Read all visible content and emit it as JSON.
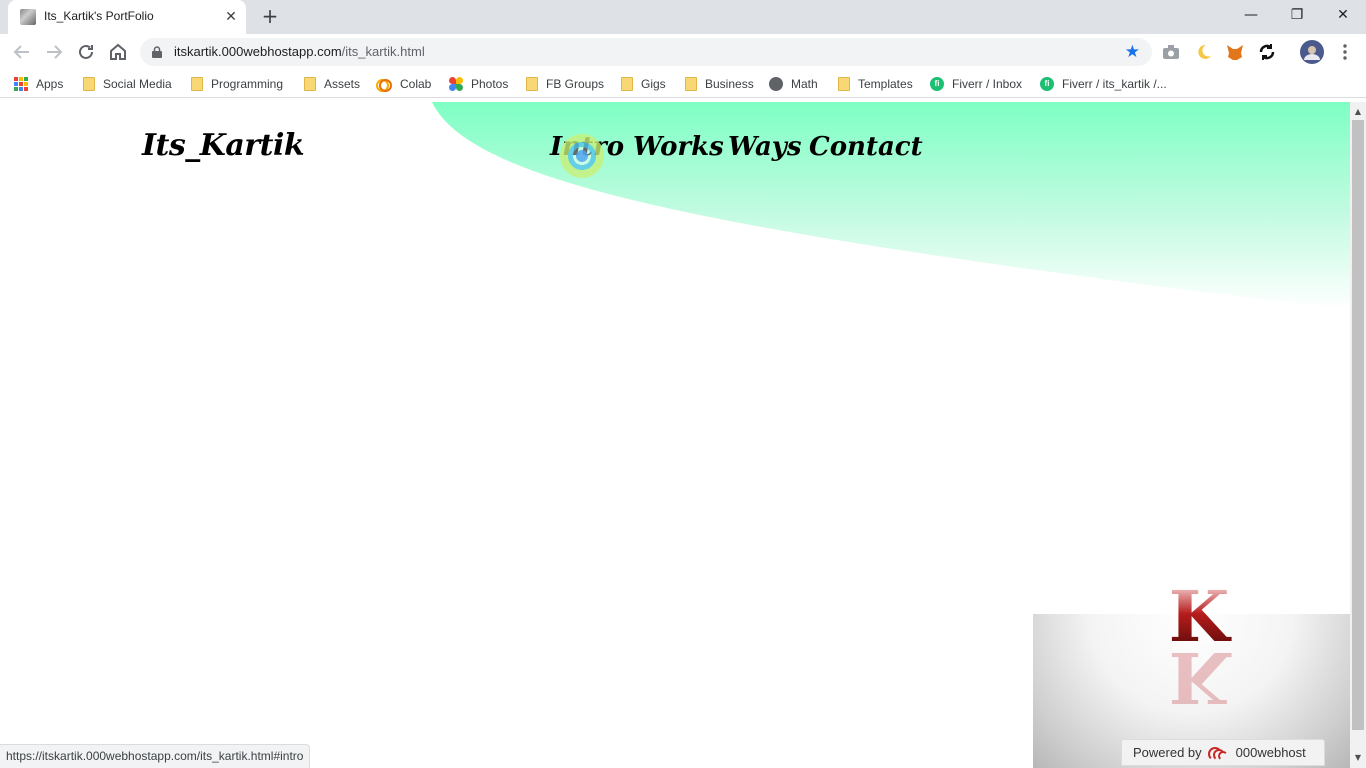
{
  "browser": {
    "tab_title": "Its_Kartik's PortFolio",
    "new_tab_symbol": "+",
    "close_tab_symbol": "✕",
    "window": {
      "minimize": "—",
      "maximize": "❐",
      "close": "✕"
    },
    "url_host": "itskartik.000webhostapp.com",
    "url_path": "/its_kartik.html",
    "bookmark_star": "★",
    "bookmarks": [
      {
        "label": "Apps",
        "icon": "apps-grid-icon"
      },
      {
        "label": "Social Media",
        "icon": "folder-icon"
      },
      {
        "label": "Programming",
        "icon": "folder-icon"
      },
      {
        "label": "Assets",
        "icon": "folder-icon"
      },
      {
        "label": "Colab",
        "icon": "colab-icon"
      },
      {
        "label": "Photos",
        "icon": "photos-icon"
      },
      {
        "label": "FB Groups",
        "icon": "folder-icon"
      },
      {
        "label": "Gigs",
        "icon": "folder-icon"
      },
      {
        "label": "Business",
        "icon": "folder-icon"
      },
      {
        "label": "Math",
        "icon": "globe-icon"
      },
      {
        "label": "Templates",
        "icon": "folder-icon"
      },
      {
        "label": "Fiverr / Inbox",
        "icon": "fiverr-icon"
      },
      {
        "label": "Fiverr / its_kartik /...",
        "icon": "fiverr-icon"
      }
    ],
    "status_url": "https://itskartik.000webhostapp.com/its_kartik.html#intro",
    "colors": {
      "chrome_bg": "#dee1e6",
      "accent": "#1a73e8"
    }
  },
  "site": {
    "logo": "Its_Kartik",
    "nav": {
      "intro": "Intro",
      "works": "Works",
      "ways": "Ways",
      "contact": "Contact"
    },
    "corner_logo": "K",
    "powered_by": "Powered by",
    "host_brand": "000webhost",
    "colors": {
      "wave_top": "#7effc4",
      "wave_bottom": "#ffffff",
      "logo_red": "#b71c1c"
    }
  }
}
